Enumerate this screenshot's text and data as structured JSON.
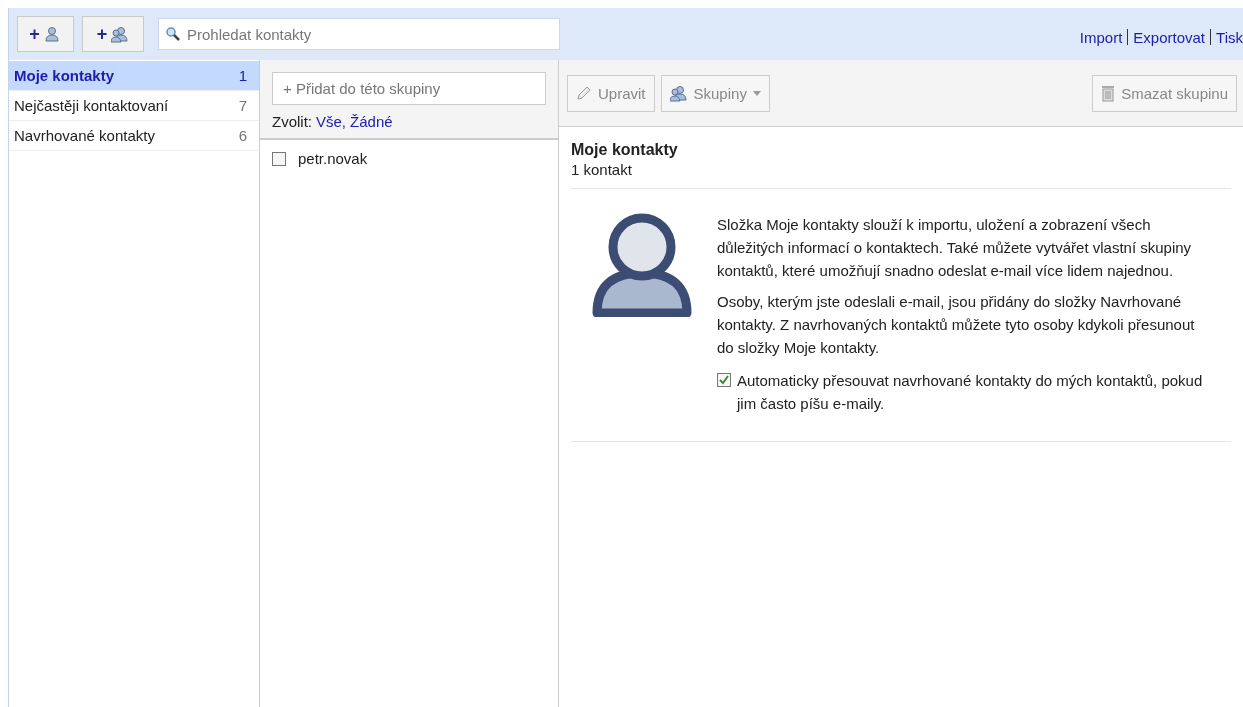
{
  "toolbar": {
    "add_contact_label": "+",
    "add_group_label": "+",
    "search": {
      "placeholder": "Prohledat kontakty"
    },
    "links": [
      "Import",
      "Exportovat",
      "Tisk"
    ]
  },
  "sidebar": {
    "items": [
      {
        "label": "Moje kontakty",
        "count": "1",
        "selected": true
      },
      {
        "label": "Nejčastěji kontaktovaní",
        "count": "7",
        "selected": false
      },
      {
        "label": "Navrhované kontakty",
        "count": "6",
        "selected": false
      }
    ]
  },
  "contact_list": {
    "add_button": "+ Přidat do této skupiny",
    "select_label": "Zvolit:",
    "select_links": [
      "Vše,",
      "Žádné"
    ],
    "contacts": [
      {
        "name": "petr.novak",
        "checked": false
      }
    ]
  },
  "detail": {
    "buttons": [
      {
        "label": "Upravit",
        "kind": "edit"
      },
      {
        "label": "Skupiny",
        "kind": "groups"
      }
    ],
    "delete_button": "Smazat skupinu",
    "title": "Moje kontakty",
    "subtitle": "1 kontakt",
    "paragraphs": [
      "Složka Moje kontakty slouží k importu, uložení a zobrazení všech důležitých informací o kontaktech. Také můžete vytvářet vlastní skupiny kontaktů, které umožňují snadno odeslat e-mail více lidem najednou.",
      "Osoby, kterým jste odeslali e-mail, jsou přidány do složky Navrhované kontakty. Z navrhovaných kontaktů můžete tyto osoby kdykoli přesunout do složky Moje kontakty."
    ],
    "auto_move": {
      "label": "Automaticky přesouvat navrhované kontakty do mých kontaktů, pokud jim často píšu e-maily.",
      "checked": true
    }
  }
}
